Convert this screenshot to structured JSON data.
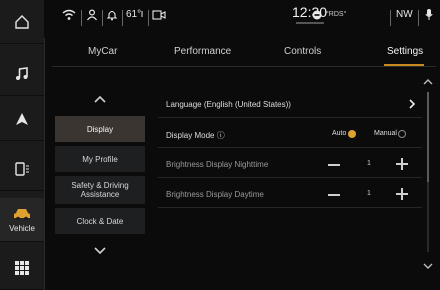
{
  "status_bar": {
    "temperature": "61°",
    "time": "12:30",
    "station": "°RDS°",
    "compass": "NW"
  },
  "rail": {
    "items": [
      {
        "icon": "home-icon"
      },
      {
        "icon": "music-note-icon"
      },
      {
        "icon": "navigation-arrow-icon"
      },
      {
        "icon": "phone-icon"
      },
      {
        "icon": "car-icon",
        "label": "Vehicle"
      },
      {
        "icon": "apps-grid-icon"
      }
    ]
  },
  "tabs": [
    {
      "label": "MyCar"
    },
    {
      "label": "Performance"
    },
    {
      "label": "Controls"
    },
    {
      "label": "Settings"
    }
  ],
  "submenu": {
    "items": [
      {
        "label": "Display"
      },
      {
        "label": "My Profile"
      },
      {
        "label": "Safety & Driving Assistance"
      },
      {
        "label": "Clock & Date"
      }
    ]
  },
  "settings": {
    "language": {
      "label": "Language (English (United States))"
    },
    "display_mode": {
      "label": "Display Mode ⓘ",
      "auto": "Auto",
      "manual": "Manual"
    },
    "night": {
      "label": "Brightness Display Nighttime",
      "value": "1"
    },
    "day": {
      "label": "Brightness Display Daytime",
      "value": "1"
    }
  },
  "colors": {
    "accent": "#e0a030"
  }
}
